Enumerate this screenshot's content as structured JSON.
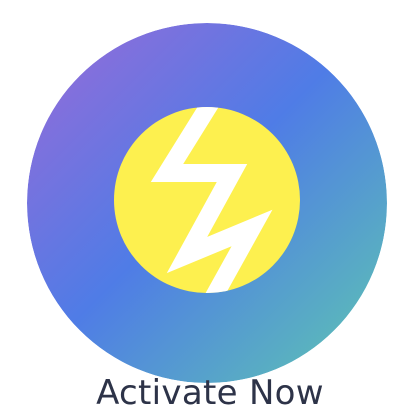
{
  "button": {
    "label": "Activate Now",
    "icon": "lightning-bolt-icon"
  },
  "colors": {
    "gradient_start": "#9a6ad8",
    "gradient_mid": "#4f7ce6",
    "gradient_end": "#5ec8b0",
    "inner_circle": "#fdf04f",
    "bolt": "#ffffff",
    "label_text": "#2d3348",
    "background": "#ffffff"
  }
}
